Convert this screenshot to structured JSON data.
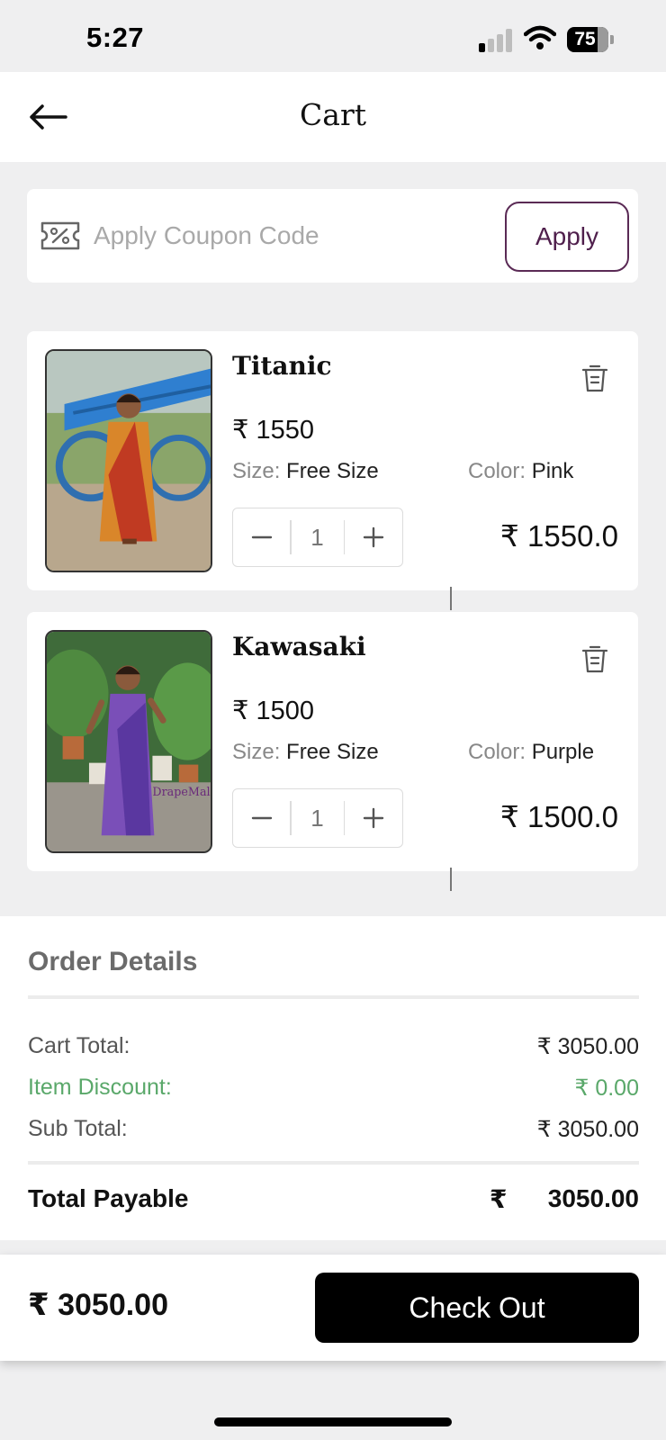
{
  "status_bar": {
    "time": "5:27",
    "battery": "75"
  },
  "header": {
    "title": "Cart"
  },
  "coupon": {
    "placeholder": "Apply Coupon Code",
    "apply_label": "Apply"
  },
  "cart": {
    "items": [
      {
        "name": "Titanic",
        "price": "₹ 1550",
        "size_label": "Size:",
        "size": "Free Size",
        "color_label": "Color:",
        "color": "Pink",
        "quantity": "1",
        "line_total": "₹ 1550.0"
      },
      {
        "name": "Kawasaki",
        "price": "₹ 1500",
        "size_label": "Size:",
        "size": "Free Size",
        "color_label": "Color:",
        "color": "Purple",
        "quantity": "1",
        "line_total": "₹ 1500.0",
        "image_watermark": "DrapeMall"
      }
    ]
  },
  "order_details": {
    "title": "Order Details",
    "cart_total_label": "Cart Total:",
    "cart_total": "₹ 3050.00",
    "item_discount_label": "Item Discount:",
    "item_discount": "₹ 0.00",
    "sub_total_label": "Sub Total:",
    "sub_total": "₹ 3050.00",
    "total_payable_label": "Total Payable",
    "total_payable_currency": "₹",
    "total_payable": "3050.00"
  },
  "bottom_bar": {
    "total": "₹ 3050.00",
    "checkout_label": "Check Out"
  },
  "colors": {
    "accent": "#5a2a55",
    "discount": "#5aa86a",
    "checkout": "#000000"
  }
}
